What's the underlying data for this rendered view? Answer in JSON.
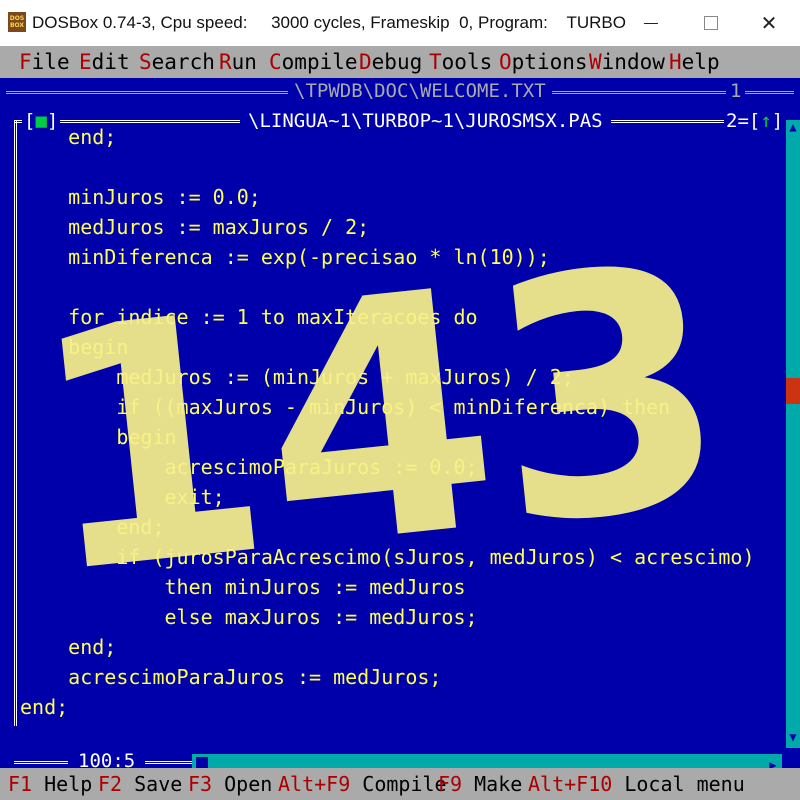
{
  "window": {
    "title": "DOSBox 0.74-3, Cpu speed:     3000 cycles, Frameskip  0, Program:    TURBO",
    "icon_text": "DOS BOX",
    "controls": [
      "minimize-icon",
      "maximize-icon",
      "close-icon"
    ],
    "close_glyph": "✕"
  },
  "menubar": {
    "items": [
      {
        "hot": "F",
        "rest": "ile"
      },
      {
        "hot": "E",
        "rest": "dit"
      },
      {
        "hot": "S",
        "rest": "earch"
      },
      {
        "hot": "R",
        "rest": "un"
      },
      {
        "hot": "C",
        "rest": "ompile"
      },
      {
        "hot": "D",
        "rest": "ebug"
      },
      {
        "hot": "T",
        "rest": "ools"
      },
      {
        "hot": "O",
        "rest": "ptions"
      },
      {
        "hot": "W",
        "rest": "indow"
      },
      {
        "hot": "H",
        "rest": "elp"
      }
    ]
  },
  "background_window": {
    "title": "\\TPWDB\\DOC\\WELCOME.TXT",
    "number": "1"
  },
  "editor": {
    "close_button_left": "[",
    "close_button_mark": "■",
    "close_button_right": "]",
    "title": "\\LINGUA~1\\TURBOP~1\\JUROSMSX.PAS",
    "number": "2=[",
    "zoom_mark": "↑",
    "number_close": "]",
    "cursor_position": "100:5",
    "code_lines": [
      "    end;",
      "",
      "    minJuros := 0.0;",
      "    medJuros := maxJuros / 2;",
      "    minDiferenca := exp(-precisao * ln(10));",
      "",
      "    for indice := 1 to maxIteracoes do",
      "    begin",
      "        medJuros := (minJuros + maxJuros) / 2;",
      "        if ((maxJuros - minJuros) < minDiferenca) then",
      "        begin",
      "            acrescimoParaJuros := 0.0;",
      "            exit;",
      "        end;",
      "        if (jurosParaAcrescimo(sJuros, medJuros) < acrescimo)",
      "            then minJuros := medJuros",
      "            else maxJuros := medJuros;",
      "    end;",
      "    acrescimoParaJuros := medJuros;",
      "end;"
    ]
  },
  "statusbar": {
    "items": [
      {
        "key": "F1",
        "label": " Help"
      },
      {
        "key": "F2",
        "label": " Save"
      },
      {
        "key": "F3",
        "label": " Open"
      },
      {
        "key": "Alt+F9",
        "label": " Compile"
      },
      {
        "key": "F9",
        "label": " Make"
      },
      {
        "key": "Alt+F10",
        "label": " Local menu"
      }
    ]
  },
  "overlay": {
    "text": "143",
    "color": "#f6f08a"
  },
  "colors": {
    "editor_bg": "#0000aa",
    "code_text": "#ffff55",
    "menu_bg": "#aaaaaa",
    "hotkey": "#aa0000",
    "scrollbar": "#00aaaa",
    "scroll_thumb": "#cc3311"
  }
}
